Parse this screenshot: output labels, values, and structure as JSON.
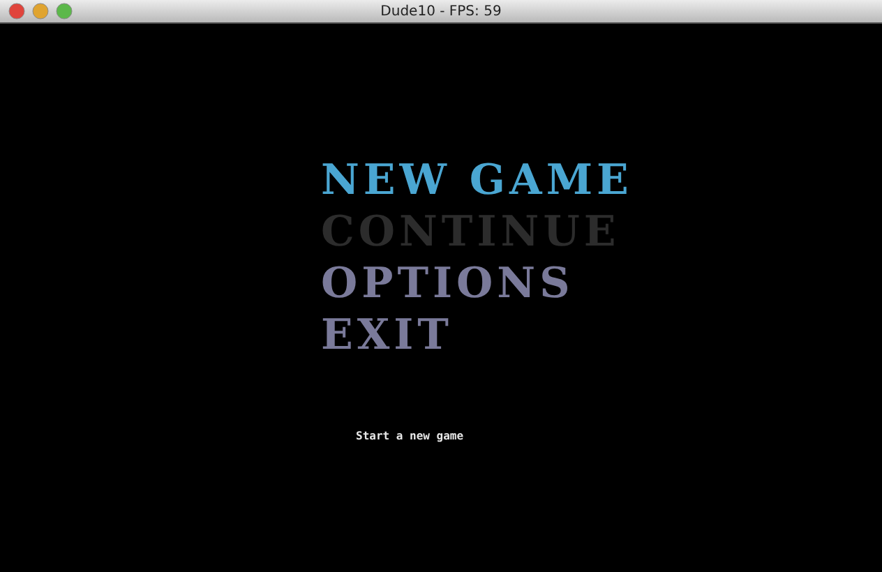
{
  "window": {
    "title": "Dude10 - FPS: 59"
  },
  "menu": [
    {
      "label": "NEW GAME",
      "selected": true,
      "disabled": false
    },
    {
      "label": "CONTINUE",
      "selected": false,
      "disabled": true
    },
    {
      "label": "OPTIONS",
      "selected": false,
      "disabled": false
    },
    {
      "label": "EXIT",
      "selected": false,
      "disabled": false
    }
  ],
  "hint": "Start a new game"
}
